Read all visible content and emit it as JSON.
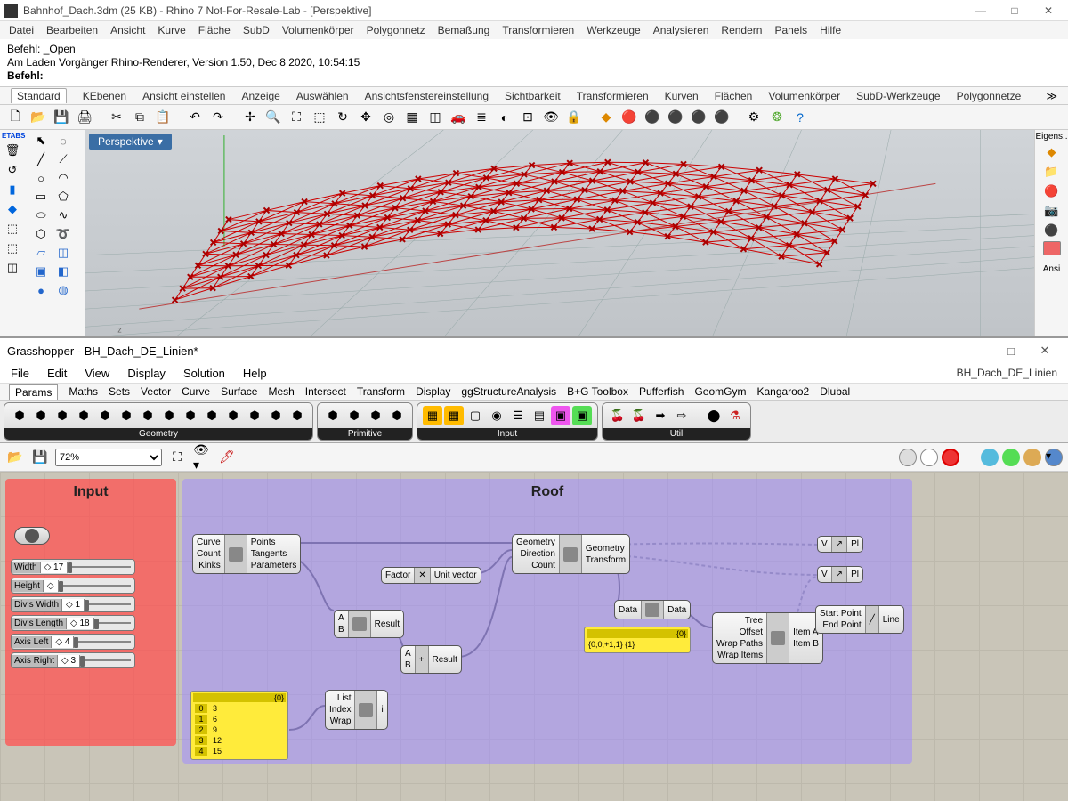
{
  "rhino": {
    "title": "Bahnhof_Dach.3dm (25 KB) - Rhino 7 Not-For-Resale-Lab - [Perspektive]",
    "menu": [
      "Datei",
      "Bearbeiten",
      "Ansicht",
      "Kurve",
      "Fläche",
      "SubD",
      "Volumenkörper",
      "Polygonnetz",
      "Bemaßung",
      "Transformieren",
      "Werkzeuge",
      "Analysieren",
      "Rendern",
      "Panels",
      "Hilfe"
    ],
    "cmd_line1": "Befehl: _Open",
    "cmd_line2": "Am Laden Vorgänger Rhino-Renderer, Version 1.50, Dec  8 2020, 10:54:15",
    "cmd_prompt": "Befehl:",
    "tabs": [
      "Standard",
      "KEbenen",
      "Ansicht einstellen",
      "Anzeige",
      "Auswählen",
      "Ansichtsfenstereinstellung",
      "Sichtbarkeit",
      "Transformieren",
      "Kurven",
      "Flächen",
      "Volumenkörper",
      "SubD-Werkzeuge",
      "Polygonnetze"
    ],
    "viewport_label": "Perspektive",
    "right_label": "Eigens..",
    "right_label2": "Ansi",
    "etabs": "ETABS"
  },
  "gh": {
    "title": "Grasshopper - BH_Dach_DE_Linien*",
    "docname": "BH_Dach_DE_Linien",
    "menu": [
      "File",
      "Edit",
      "View",
      "Display",
      "Solution",
      "Help"
    ],
    "tabs": [
      "Params",
      "Maths",
      "Sets",
      "Vector",
      "Curve",
      "Surface",
      "Mesh",
      "Intersect",
      "Transform",
      "Display",
      "ggStructureAnalysis",
      "B+G Toolbox",
      "Pufferfish",
      "GeomGym",
      "Kangaroo2",
      "Dlubal"
    ],
    "ribbon_groups": [
      "Geometry",
      "Primitive",
      "Input",
      "Util"
    ],
    "zoom": "72%",
    "groups": {
      "input": "Input",
      "roof": "Roof"
    },
    "sliders": [
      {
        "label": "Width",
        "value": "17"
      },
      {
        "label": "Height",
        "value": ""
      },
      {
        "label": "Divis Width",
        "value": "1"
      },
      {
        "label": "Divis Length",
        "value": "18"
      },
      {
        "label": "Axis Left",
        "value": "4"
      },
      {
        "label": "Axis Right",
        "value": "3"
      }
    ],
    "comp_divide": {
      "in": [
        "Curve",
        "Count",
        "Kinks"
      ],
      "out": [
        "Points",
        "Tangents",
        "Parameters"
      ]
    },
    "comp_unit": {
      "in": "Factor",
      "mid": "✕",
      "out": "Unit vector"
    },
    "comp_eval": {
      "in": [
        "A",
        "B"
      ],
      "out": "Result"
    },
    "comp_add": {
      "in": [
        "A",
        "B"
      ],
      "mid": "+",
      "out": "Result"
    },
    "comp_listitem": {
      "in": [
        "List",
        "Index",
        "Wrap"
      ],
      "out": "i"
    },
    "comp_orient": {
      "in": [
        "Geometry",
        "Direction",
        "Count"
      ],
      "out": [
        "Geometry",
        "Transform"
      ]
    },
    "comp_data": {
      "in": "Data",
      "out": "Data"
    },
    "comp_tree": {
      "in": [
        "Tree",
        "Offset",
        "Wrap Paths",
        "Wrap Items"
      ],
      "out": [
        "Item A",
        "Item B"
      ]
    },
    "comp_line": {
      "in": [
        "Start Point",
        "End Point"
      ],
      "out": "Line"
    },
    "comp_flatten": {
      "in": "V",
      "out": "Pl"
    },
    "panel_list": {
      "hdr": "{0}",
      "rows": [
        [
          "0",
          "3"
        ],
        [
          "1",
          "6"
        ],
        [
          "2",
          "9"
        ],
        [
          "3",
          "12"
        ],
        [
          "4",
          "15"
        ]
      ]
    },
    "panel_small": {
      "hdr": "{0}",
      "text": "{0;0;+1;1} {1}"
    }
  }
}
